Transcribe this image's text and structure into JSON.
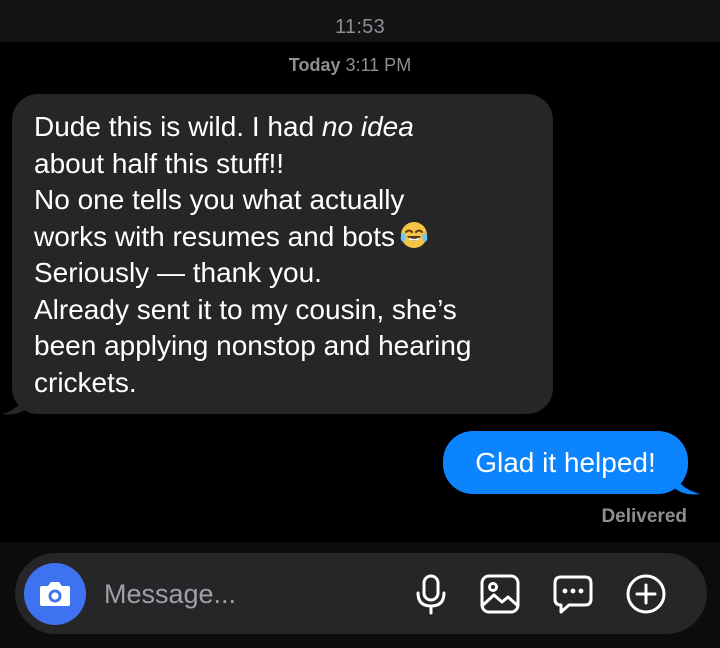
{
  "status_bar": {
    "time": "11:53"
  },
  "conversation": {
    "timestamp": {
      "day": "Today",
      "time": "3:11 PM"
    },
    "incoming_message": {
      "lines": [
        {
          "before": "Dude this is wild. I had ",
          "emphasis": "no idea"
        },
        "about half this stuff!!",
        "No one tells you what actually",
        "works with resumes and bots",
        "Seriously — thank you.",
        "Already sent it to my cousin, she’s",
        "been applying nonstop and hearing",
        "crickets."
      ],
      "emoji": "😂",
      "emoji_icon": "face-with-tears-of-joy-icon"
    },
    "outgoing_message": {
      "text": "Glad it helped!",
      "status": "Delivered"
    }
  },
  "composer": {
    "placeholder": "Message...",
    "icons": [
      "camera-icon",
      "microphone-icon",
      "gallery-icon",
      "sticker-icon",
      "plus-icon"
    ]
  },
  "colors": {
    "background": "#000000",
    "incoming_bubble": "#262628",
    "outgoing_bubble": "#0b84fe",
    "camera_button": "#3f72f0",
    "secondary_text": "#8e8e93"
  }
}
